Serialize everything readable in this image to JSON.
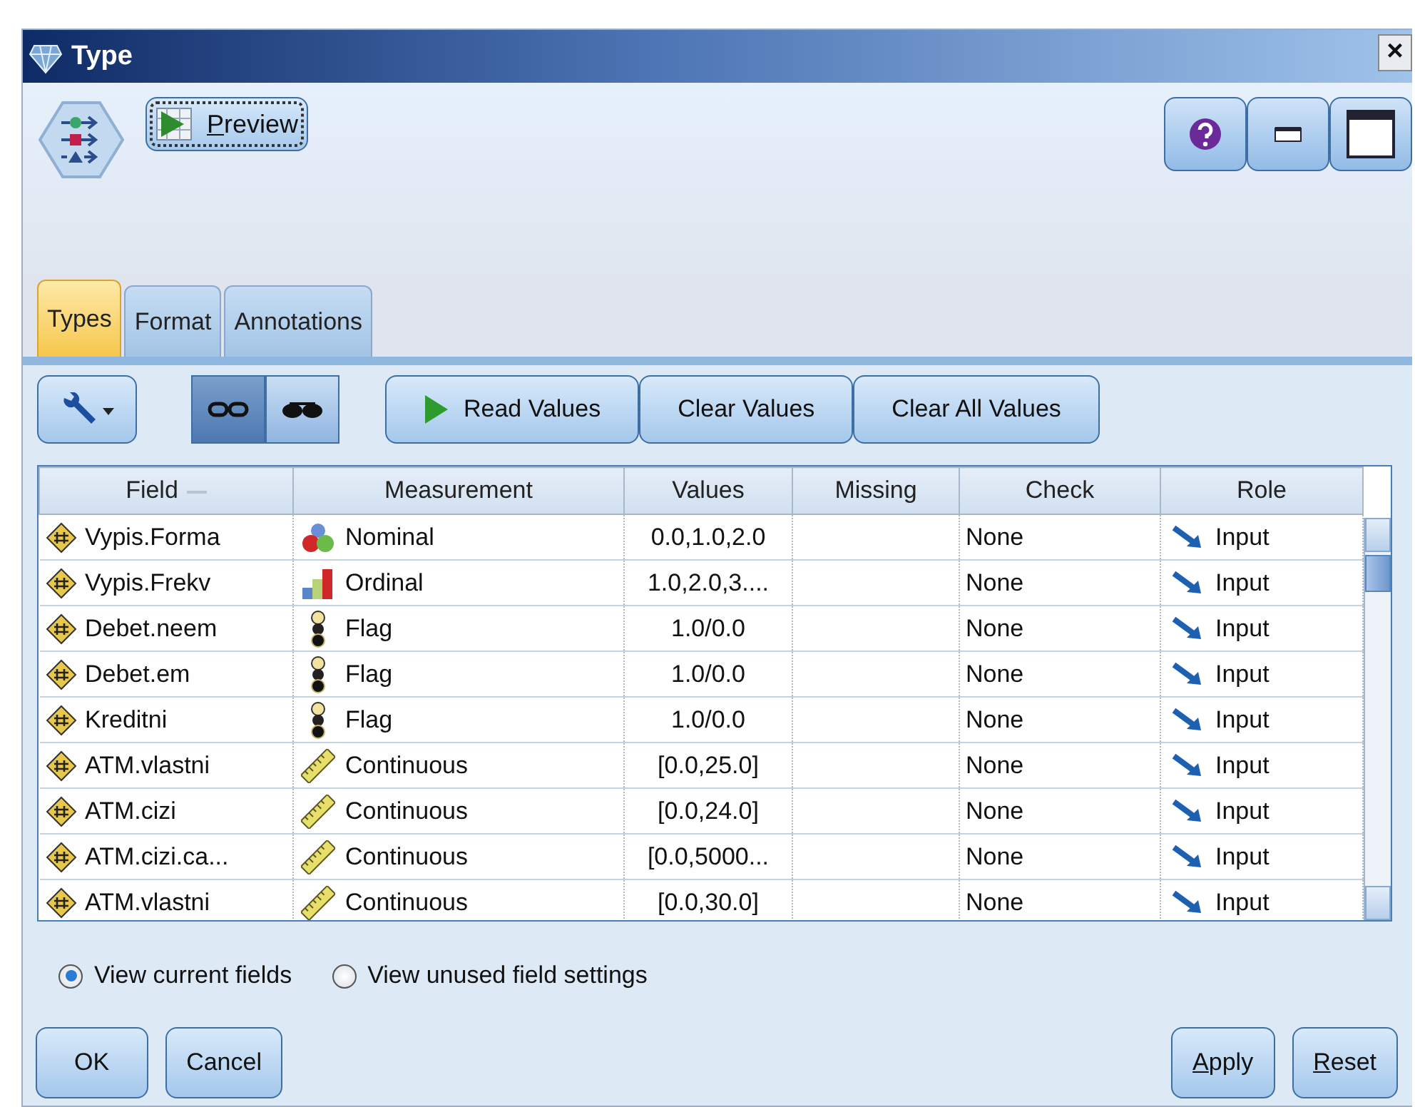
{
  "window": {
    "title": "Type",
    "close": "×"
  },
  "header": {
    "preview": {
      "label": "Preview",
      "mnemonic": true
    }
  },
  "tabs": [
    {
      "label": "Types",
      "selected": true
    },
    {
      "label": "Format",
      "selected": false
    },
    {
      "label": "Annotations",
      "selected": false
    }
  ],
  "toolbar": {
    "view_toggles": [
      {
        "selected": true
      },
      {
        "selected": false
      }
    ],
    "buttons": [
      {
        "label": "Read Values",
        "kind": "play"
      },
      {
        "label": "Clear Values",
        "kind": "plain"
      },
      {
        "label": "Clear All Values",
        "kind": "plain"
      }
    ]
  },
  "table": {
    "columns": [
      "Field",
      "Measurement",
      "Values",
      "Missing",
      "Check",
      "Role"
    ],
    "rows": [
      {
        "field": "Vypis.Forma",
        "measurement": "Nominal",
        "kind": "nominal",
        "values": "0.0,1.0,2.0",
        "missing": "",
        "check": "None",
        "role": "Input"
      },
      {
        "field": "Vypis.Frekv",
        "measurement": "Ordinal",
        "kind": "ordinal",
        "values": "1.0,2.0,3....",
        "missing": "",
        "check": "None",
        "role": "Input"
      },
      {
        "field": "Debet.neem",
        "measurement": "Flag",
        "kind": "flag",
        "values": "1.0/0.0",
        "missing": "",
        "check": "None",
        "role": "Input"
      },
      {
        "field": "Debet.em",
        "measurement": "Flag",
        "kind": "flag",
        "values": "1.0/0.0",
        "missing": "",
        "check": "None",
        "role": "Input"
      },
      {
        "field": "Kreditni",
        "measurement": "Flag",
        "kind": "flag",
        "values": "1.0/0.0",
        "missing": "",
        "check": "None",
        "role": "Input"
      },
      {
        "field": "ATM.vlastni",
        "measurement": "Continuous",
        "kind": "continuous",
        "values": "[0.0,25.0]",
        "missing": "",
        "check": "None",
        "role": "Input"
      },
      {
        "field": "ATM.cizi",
        "measurement": "Continuous",
        "kind": "continuous",
        "values": "[0.0,24.0]",
        "missing": "",
        "check": "None",
        "role": "Input"
      },
      {
        "field": "ATM.cizi.ca...",
        "measurement": "Continuous",
        "kind": "continuous",
        "values": "[0.0,5000...",
        "missing": "",
        "check": "None",
        "role": "Input"
      },
      {
        "field": "ATM.vlastni",
        "measurement": "Continuous",
        "kind": "continuous",
        "values": "[0.0,30.0]",
        "missing": "",
        "check": "None",
        "role": "Input"
      }
    ]
  },
  "view_options": [
    {
      "label": "View current fields",
      "selected": true
    },
    {
      "label": "View unused field settings",
      "selected": false
    }
  ],
  "buttons_left": [
    {
      "label": "OK",
      "mnemonic": false
    },
    {
      "label": "Cancel",
      "mnemonic": false
    }
  ],
  "buttons_right": [
    {
      "label": "Apply",
      "mnemonic": true
    },
    {
      "label": "Reset",
      "mnemonic": true
    }
  ]
}
